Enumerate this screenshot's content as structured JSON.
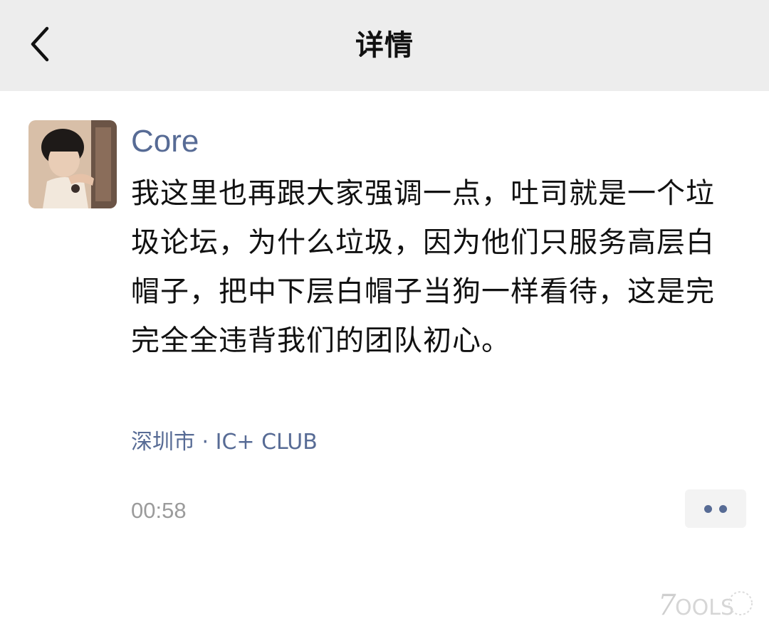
{
  "header": {
    "title": "详情",
    "back_icon": "chevron-left-icon",
    "background": "#ededed"
  },
  "post": {
    "author": "Core",
    "text": "我这里也再跟大家强调一点，吐司就是一个垃圾论坛，为什么垃圾，因为他们只服务高层白帽子，把中下层白帽子当狗一样看待，这是完完全全违背我们的团队初心。",
    "location": "深圳市 · IC+ CLUB",
    "time": "00:58",
    "more_icon": "more-dots-icon"
  },
  "watermark": {
    "text": "7OOLS"
  },
  "colors": {
    "link": "#576b95",
    "text": "#111111",
    "muted": "#9b9b9b"
  }
}
